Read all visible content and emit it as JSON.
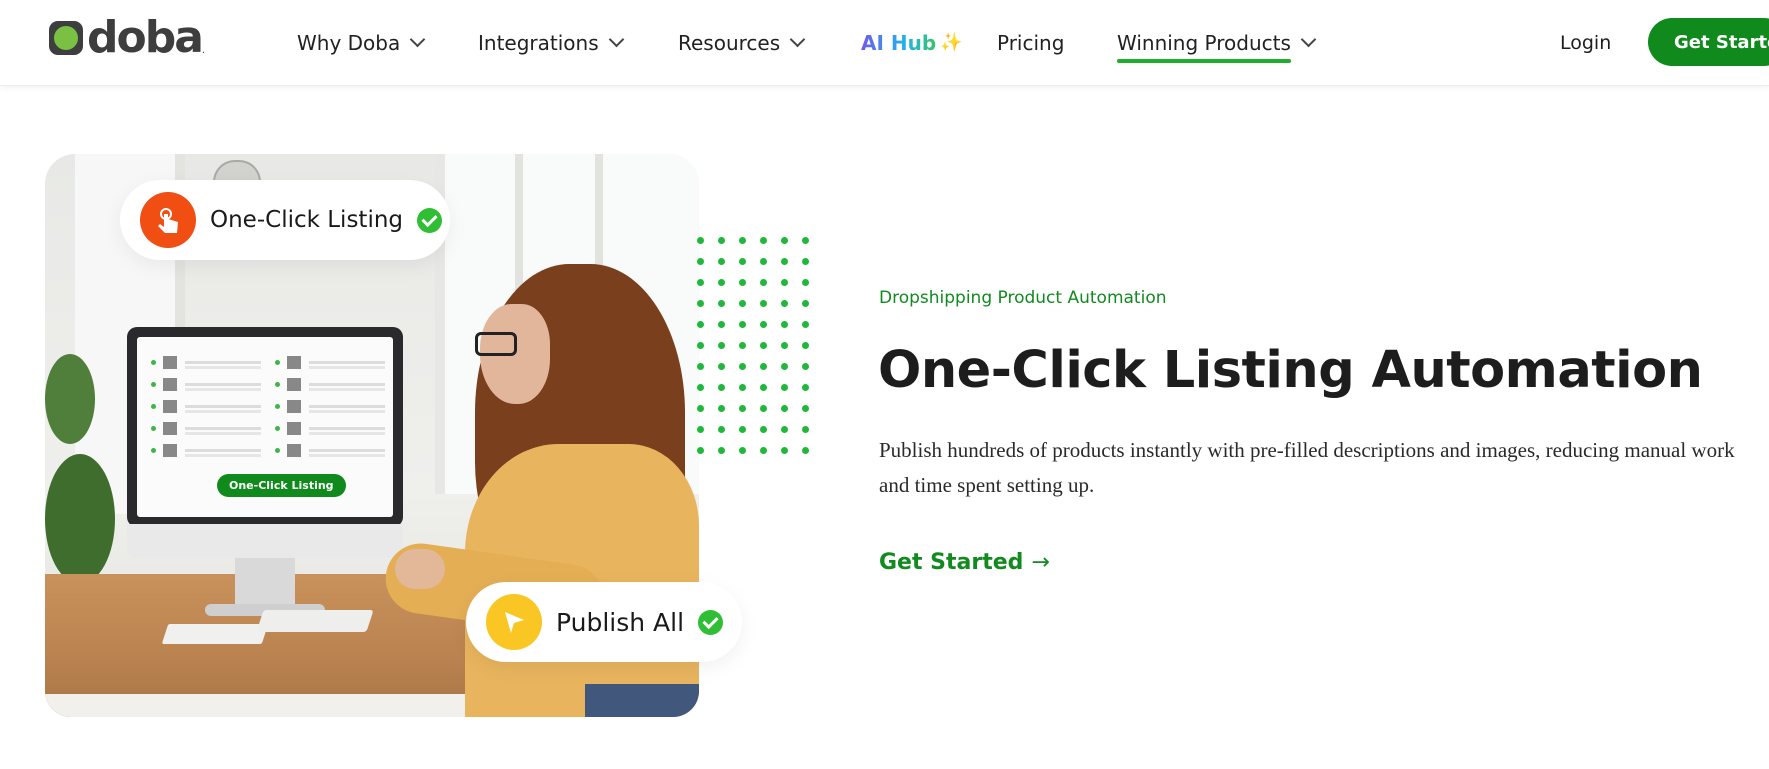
{
  "header": {
    "logo_text": "doba",
    "logo_suffix": ".",
    "nav": [
      {
        "label": "Why Doba"
      },
      {
        "label": "Integrations"
      },
      {
        "label": "Resources"
      },
      {
        "label": "AI Hub"
      },
      {
        "label": "Pricing"
      },
      {
        "label": "Winning Products"
      }
    ],
    "ai_hub_sparkle": "✨",
    "login_label": "Login",
    "cta_label": "Get Started"
  },
  "hero": {
    "image_badges": {
      "top_label": "One-Click Listing",
      "bottom_label": "Publish All",
      "screen_pill": "One-Click Listing"
    },
    "eyebrow": "Dropshipping Product Automation",
    "title": "One-Click Listing Automation",
    "description": "Publish hundreds of products instantly with pre-filled descriptions and images, reducing manual work and time spent setting up.",
    "cta_label": "Get Started",
    "cta_arrow": "→"
  },
  "colors": {
    "brand_green": "#108a1c",
    "accent_green": "#1fb83a",
    "orange_icon": "#f04e12",
    "yellow_icon": "#f9c623"
  },
  "icons": {
    "touch": "hand-tap-icon",
    "send": "send-arrow-icon",
    "check": "check-circle-icon"
  }
}
